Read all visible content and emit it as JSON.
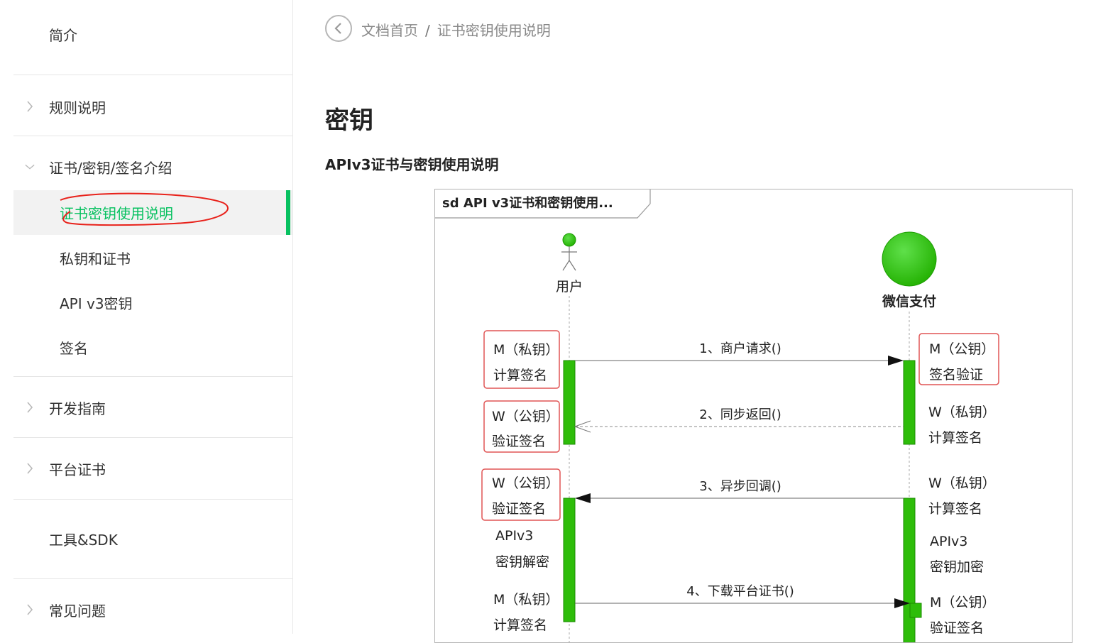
{
  "sidebar": {
    "intro": "简介",
    "rules": "规则说明",
    "cert_section": "证书/密钥/签名介绍",
    "sub_items": [
      "证书密钥使用说明",
      "私钥和证书",
      "API v3密钥",
      "签名"
    ],
    "dev_guide": "开发指南",
    "platform_cert": "平台证书",
    "tools": "工具&SDK",
    "faq": "常见问题"
  },
  "breadcrumb": {
    "home": "文档首页",
    "separator": "/",
    "current": "证书密钥使用说明"
  },
  "page": {
    "title": "密钥",
    "section_title": "APIv3证书与密钥使用说明"
  },
  "diagram": {
    "frame_title": "sd API v3证书和密钥使用...",
    "actor_user": "用户",
    "actor_wechat": "微信支付",
    "messages": [
      "1、商户请求()",
      "2、同步返回()",
      "3、异步回调()",
      "4、下载平台证书()"
    ],
    "left_notes": [
      [
        "M（私钥）",
        "计算签名"
      ],
      [
        "W（公钥）",
        "验证签名"
      ],
      [
        "W（公钥）",
        "验证签名"
      ],
      [
        "APIv3",
        "密钥解密"
      ],
      [
        "M（私钥）",
        "计算签名"
      ]
    ],
    "right_notes": [
      [
        "M（公钥）",
        "签名验证"
      ],
      [
        "W（私钥）",
        "计算签名"
      ],
      [
        "W（私钥）",
        "计算签名"
      ],
      [
        "APIv3",
        "密钥加密"
      ],
      [
        "M（公钥）",
        "验证签名"
      ]
    ]
  },
  "colors": {
    "accent": "#07c160",
    "activation": "#2ebd0a",
    "note_border": "#e05555",
    "annotation": "#e8221b"
  },
  "icons": [
    "chevron-right-icon",
    "chevron-down-icon",
    "chevron-left-icon",
    "stick-figure-icon",
    "circle-entity-icon"
  ]
}
